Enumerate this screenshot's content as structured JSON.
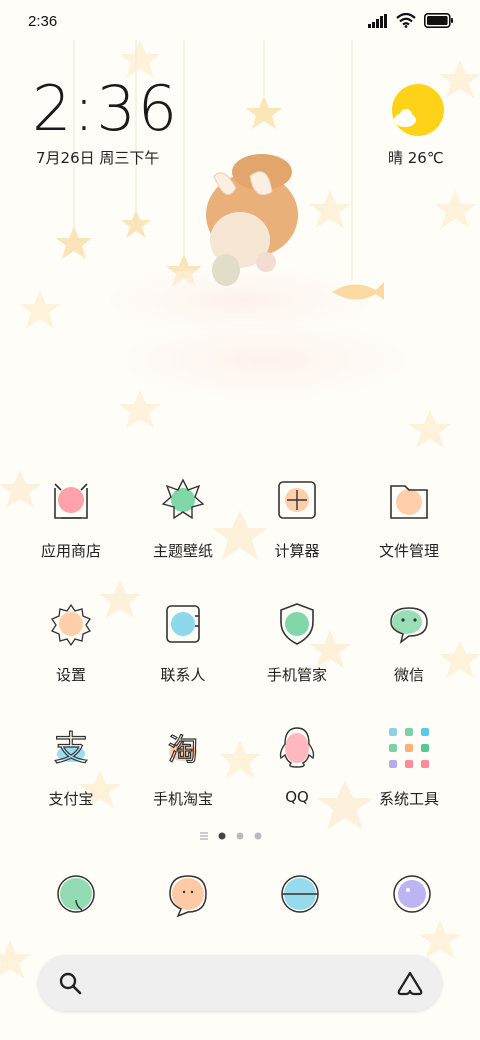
{
  "status_bar": {
    "time": "2:36"
  },
  "clock_widget": {
    "time": "2:36",
    "date": "7月26日 周三下午"
  },
  "weather_widget": {
    "text": "晴 26℃",
    "icon": "sunny-cloud-icon"
  },
  "apps": [
    {
      "label": "应用商店",
      "icon": "app-store-icon",
      "color": "#ff7a8a"
    },
    {
      "label": "主题壁纸",
      "icon": "themes-icon",
      "color": "#57c98e"
    },
    {
      "label": "计算器",
      "icon": "calculator-icon",
      "color": "#ffb07a"
    },
    {
      "label": "文件管理",
      "icon": "file-manager-icon",
      "color": "#ffb07a"
    },
    {
      "label": "设置",
      "icon": "settings-icon",
      "color": "#ffb07a"
    },
    {
      "label": "联系人",
      "icon": "contacts-icon",
      "color": "#5cc8e6"
    },
    {
      "label": "手机管家",
      "icon": "security-icon",
      "color": "#57c98e"
    },
    {
      "label": "微信",
      "icon": "wechat-icon",
      "color": "#57c98e"
    },
    {
      "label": "支付宝",
      "icon": "alipay-icon",
      "color": "#5cc8e6"
    },
    {
      "label": "手机淘宝",
      "icon": "taobao-icon",
      "color": "#ffb07a"
    },
    {
      "label": "QQ",
      "icon": "qq-icon",
      "color": "#ff8a9a"
    },
    {
      "label": "系统工具",
      "icon": "system-tools-folder-icon",
      "color": "#c8c8c8"
    }
  ],
  "page_indicator": {
    "pages": 3,
    "current": 1
  },
  "dock": [
    {
      "icon": "phone-icon",
      "color": "#57c98e"
    },
    {
      "icon": "messages-icon",
      "color": "#ffb07a"
    },
    {
      "icon": "browser-icon",
      "color": "#5cc8e6"
    },
    {
      "icon": "camera-icon",
      "color": "#9a8ef0"
    }
  ],
  "search": {
    "icon": "search-icon",
    "assistant_icon": "assistant-icon"
  }
}
